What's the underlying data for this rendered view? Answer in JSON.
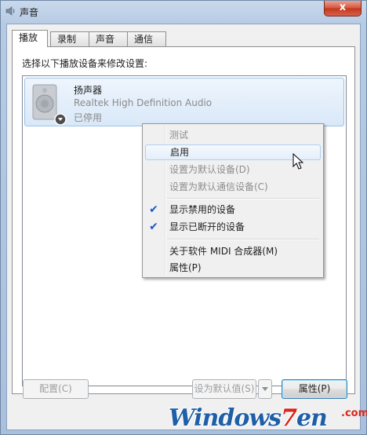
{
  "window": {
    "title": "声音",
    "close_glyph": "x"
  },
  "tabs": [
    {
      "label": "播放",
      "active": true
    },
    {
      "label": "录制",
      "active": false
    },
    {
      "label": "声音",
      "active": false
    },
    {
      "label": "通信",
      "active": false
    }
  ],
  "instruction": "选择以下播放设备来修改设置:",
  "device": {
    "name": "扬声器",
    "description": "Realtek High Definition Audio",
    "status": "已停用"
  },
  "context_menu": {
    "items": [
      {
        "label": "测试",
        "enabled": false
      },
      {
        "label": "启用",
        "enabled": true,
        "hover": true
      },
      {
        "label": "设置为默认设备(D)",
        "enabled": false
      },
      {
        "label": "设置为默认通信设备(C)",
        "enabled": false
      },
      {
        "label": "显示禁用的设备",
        "enabled": true,
        "checked": true
      },
      {
        "label": "显示已断开的设备",
        "enabled": true,
        "checked": true
      },
      {
        "label": "关于软件 MIDI 合成器(M)",
        "enabled": true
      },
      {
        "label": "属性(P)",
        "enabled": true
      }
    ]
  },
  "buttons": {
    "configure": "配置(C)",
    "set_default": "设为默认值(S)",
    "properties": "属性(P)"
  },
  "watermark": {
    "text_main": "Windows",
    "text_seven": "7",
    "text_suffix": "en",
    "dot_com": ".com"
  },
  "colors": {
    "check": "#1c57c9",
    "selection_border": "#9cc2e8",
    "watermark_blue": "#1f5fa8",
    "watermark_red": "#d8261c"
  }
}
